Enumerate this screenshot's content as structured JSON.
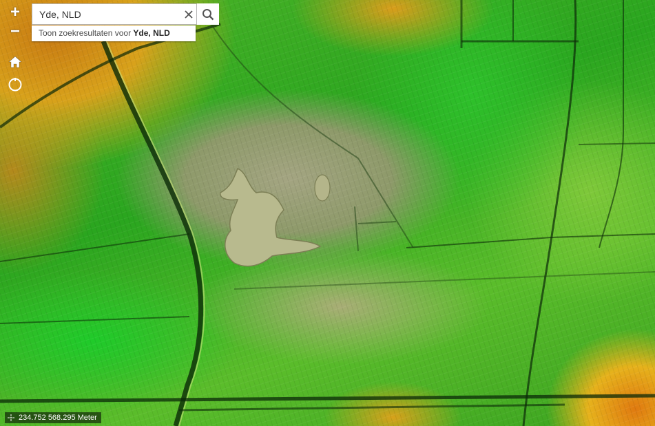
{
  "map": {
    "type": "elevation-hillshade",
    "palette": [
      "#1a9e1a",
      "#3fc22a",
      "#a4a582",
      "#d8c21b",
      "#e07a10"
    ]
  },
  "controls": {
    "zoom_in": "+",
    "zoom_out": "−",
    "home_icon": "home-icon",
    "locate_icon": "locate-icon"
  },
  "search": {
    "value": "Yde, NLD",
    "clear_icon": "close-icon",
    "search_icon": "search-icon",
    "suggestion_prefix": "Toon zoekresultaten voor ",
    "suggestion_term": "Yde, NLD"
  },
  "coordinates": {
    "text": "234.752 568.295 Meter"
  }
}
